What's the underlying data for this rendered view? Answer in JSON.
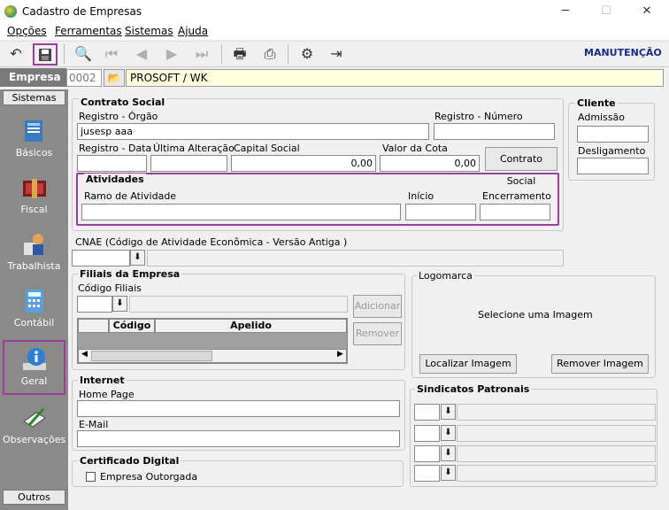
{
  "window": {
    "title": "Cadastro de Empresas",
    "minimize": "─",
    "maximize": "☐",
    "close": "✕"
  },
  "menu": {
    "items": [
      "Opções",
      "Ferramentas",
      "Sistemas",
      "Ajuda"
    ]
  },
  "toolbar": {
    "mode_label": "MANUTENÇÃO"
  },
  "empresa": {
    "label": "Empresa",
    "code": "0002",
    "name": "PROSOFT / WK"
  },
  "sidebar": {
    "header": "Sistemas",
    "footer": "Outros",
    "items": [
      {
        "label": "Básicos",
        "icon": "book-icon"
      },
      {
        "label": "Fiscal",
        "icon": "fiscal-icon"
      },
      {
        "label": "Trabalhista",
        "icon": "worker-icon"
      },
      {
        "label": "Contábil",
        "icon": "calculator-icon"
      },
      {
        "label": "Geral",
        "icon": "info-icon"
      },
      {
        "label": "Observações",
        "icon": "notes-icon"
      }
    ]
  },
  "contrato": {
    "title": "Contrato Social",
    "registro_orgao_label": "Registro - Órgão",
    "registro_orgao_value": "jusesp aaa",
    "registro_numero_label": "Registro - Número",
    "registro_numero_value": "",
    "registro_data_label": "Registro - Data",
    "ultima_alteracao_label": "Última Alteração",
    "capital_social_label": "Capital Social",
    "capital_social_value": "0,00",
    "valor_cota_label": "Valor da Cota",
    "valor_cota_value": "0,00",
    "contrato_button": "Contrato Social"
  },
  "atividades": {
    "title": "Atividades",
    "ramo_label": "Ramo de Atividade",
    "inicio_label": "Início",
    "encerramento_label": "Encerramento"
  },
  "cliente": {
    "title": "Cliente",
    "admissao_label": "Admissão",
    "desligamento_label": "Desligamento"
  },
  "cnae": {
    "label": "CNAE (Código de Atividade Econômica - Versão Antiga )"
  },
  "filiais": {
    "title": "Filiais da Empresa",
    "codigo_label": "Código Filiais",
    "columns": [
      "Código",
      "Apelido"
    ],
    "adicionar_button": "Adicionar",
    "remover_button": "Remover"
  },
  "logomarca": {
    "title": "Logomarca",
    "placeholder": "Selecione  uma  Imagem",
    "localizar_button": "Localizar Imagem",
    "remover_button": "Remover Imagem"
  },
  "internet": {
    "title": "Internet",
    "homepage_label": "Home Page",
    "email_label": "E-Mail"
  },
  "sindicatos": {
    "title": "Sindicatos Patronais"
  },
  "certificado": {
    "title": "Certificado Digital",
    "outorgada_label": "Empresa Outorgada"
  }
}
